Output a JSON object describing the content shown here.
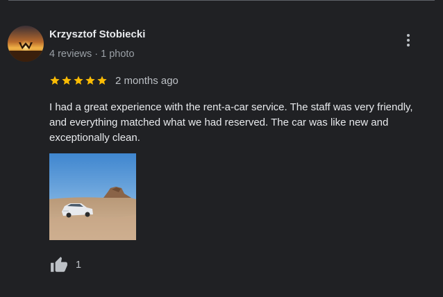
{
  "review": {
    "author_name": "Krzysztof Stobiecki",
    "author_meta": "4 reviews · 1 photo",
    "rating": 5,
    "rating_max": 5,
    "date": "2 months ago",
    "text": "I had a great experience with the rent-a-car service. The staff was very friendly, and everything matched what we had reserved. The car was like new and exceptionally clean.",
    "photo_count": 1,
    "like_count": "1"
  },
  "icons": {
    "more": "more-vert-icon",
    "star": "star-icon",
    "like": "thumb-up-icon"
  },
  "colors": {
    "background": "#202124",
    "star": "#fbbc04",
    "text_primary": "#e8eaed",
    "text_secondary": "#9aa0a6"
  }
}
